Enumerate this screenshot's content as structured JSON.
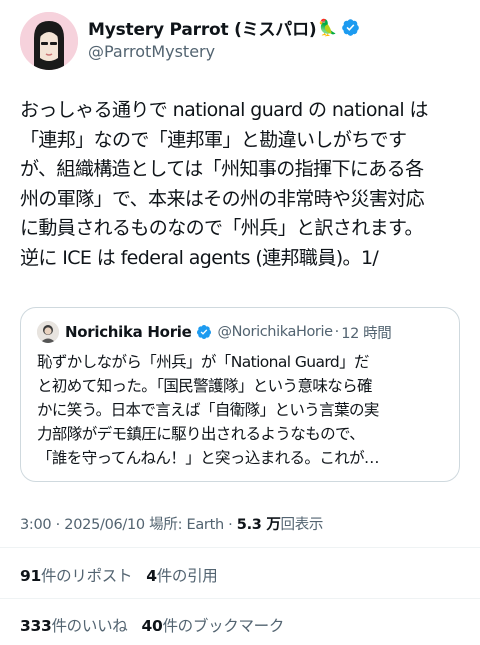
{
  "author": {
    "display_name": "Mystery Parrot (ミスパロ)",
    "parrot_emoji": "🦜",
    "verified_icon": "verified-badge-icon",
    "handle": "@ParrotMystery"
  },
  "tweet": {
    "text": "おっしゃる通りで national guard の national は\n「連邦」なので「連邦軍」と勘違いしがちです\nが、組織構造としては「州知事の指揮下にある各\n州の軍隊」で、本来はその州の非常時や災害対応\nに動員されるものなので「州兵」と訳されます。\n逆に ICE は federal agents (連邦職員)。1/"
  },
  "quote": {
    "name": "Norichika Horie",
    "handle": "@NorichikaHorie",
    "separator": "·",
    "time": "12 時間",
    "text": "恥ずかしながら「州兵」が「National Guard」だ\nと初めて知った。「国民警護隊」という意味なら確\nかに笑う。日本で言えば「自衛隊」という言葉の実\n力部隊がデモ鎮圧に駆り出されるようなもので、\n「誰を守ってんねん！」と突っ込まれる。これが…"
  },
  "meta": {
    "time": "3:00 · 2025/06/10 場所: Earth · ",
    "views_count": "5.3 万",
    "views_label": "回表示"
  },
  "stats": {
    "reposts_count": "91",
    "reposts_label": "件のリポスト",
    "quotes_count": "4",
    "quotes_label": "件の引用",
    "likes_count": "333",
    "likes_label": "件のいいね",
    "bookmarks_count": "40",
    "bookmarks_label": "件のブックマーク"
  },
  "colors": {
    "verified_blue": "#1d9bf0",
    "secondary_text": "#536471",
    "primary_text": "#0f1419",
    "border": "#cfd9de"
  }
}
